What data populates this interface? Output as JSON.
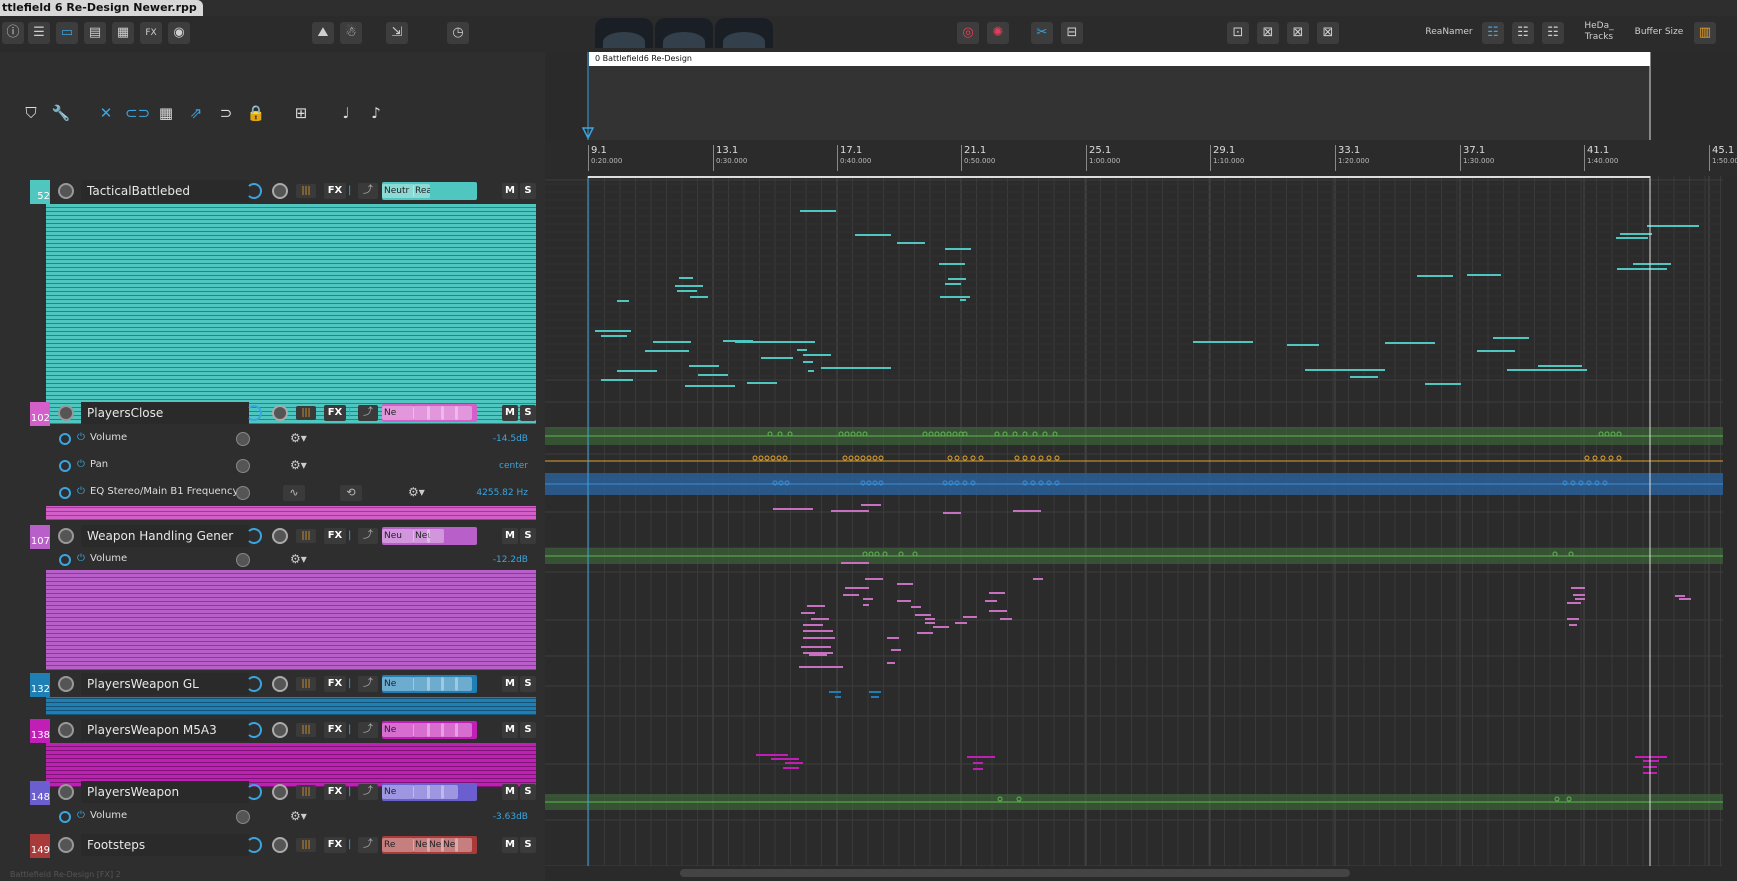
{
  "window": {
    "title": "ttlefield 6 Re-Design Newer.rpp"
  },
  "toolbar": {
    "buttons_left": [
      "i",
      "⚙",
      "▭",
      "▭",
      "▭",
      "FX",
      "💬"
    ],
    "buttons_mid": [
      "⛰",
      "⚓",
      "⇲",
      "◷"
    ],
    "rea_namer": "ReaNamer",
    "hd_tracks": [
      "HeDa_",
      "Tracks"
    ],
    "buffer_size": "Buffer Size"
  },
  "region": {
    "name": "0  Battlefield6 Re-Design"
  },
  "ruler": {
    "marks": [
      {
        "bar": "9.1",
        "time": "0:20.000"
      },
      {
        "bar": "13.1",
        "time": "0:30.000"
      },
      {
        "bar": "17.1",
        "time": "0:40.000"
      },
      {
        "bar": "21.1",
        "time": "0:50.000"
      },
      {
        "bar": "25.1",
        "time": "1:00.000"
      },
      {
        "bar": "29.1",
        "time": "1:10.000"
      },
      {
        "bar": "33.1",
        "time": "1:20.000"
      },
      {
        "bar": "37.1",
        "time": "1:30.000"
      },
      {
        "bar": "41.1",
        "time": "1:40.000"
      },
      {
        "bar": "45.1",
        "time": "1:50.000"
      }
    ]
  },
  "common": {
    "fx": "FX",
    "mute": "M",
    "solo": "S"
  },
  "tracks": [
    {
      "num": "52",
      "name": "TacticalBattlebed",
      "color": "#4fc6c0",
      "fx_slots": [
        "Neutr",
        "ReaC"
      ]
    },
    {
      "num": "102",
      "name": "PlayersClose",
      "color": "#d35fc9",
      "fx_slots": [
        "Ne",
        "",
        "",
        "",
        ""
      ]
    },
    {
      "num": "107",
      "name": "Weapon Handling Gener",
      "color": "#b85fc9",
      "fx_slots": [
        "Neu",
        "Neu",
        ""
      ]
    },
    {
      "num": "132",
      "name": "PlayersWeapon GL",
      "color": "#1f7fb5",
      "fx_slots": [
        "Ne",
        "",
        "",
        "",
        ""
      ]
    },
    {
      "num": "138",
      "name": "PlayersWeapon M5A3",
      "color": "#c01fb5",
      "fx_slots": [
        "Ne",
        "",
        "",
        "",
        ""
      ]
    },
    {
      "num": "148",
      "name": "PlayersWeapon",
      "color": "#6b5fd0",
      "fx_slots": [
        "Ne",
        "",
        "",
        ""
      ]
    },
    {
      "num": "149",
      "name": "Footsteps",
      "color": "#a83a3a",
      "fx_slots": [
        "Re",
        "Ne",
        "Ne",
        "Ne",
        ""
      ]
    }
  ],
  "lanes": [
    {
      "name": "Volume",
      "value": "-14.5dB",
      "color": "#5fb54f"
    },
    {
      "name": "Pan",
      "value": "center",
      "color": "#e0a32a"
    },
    {
      "name": "EQ Stereo/Main B1 Frequency /",
      "value": "4255.82 Hz",
      "color": "#3a8fd8"
    },
    {
      "name": "Volume",
      "value": "-12.2dB",
      "color": "#5fb54f"
    },
    {
      "name": "Volume",
      "value": "-3.63dB",
      "color": "#5fb54f"
    }
  ],
  "status": {
    "text": "Battlefield Re-Design [FX] 2"
  }
}
